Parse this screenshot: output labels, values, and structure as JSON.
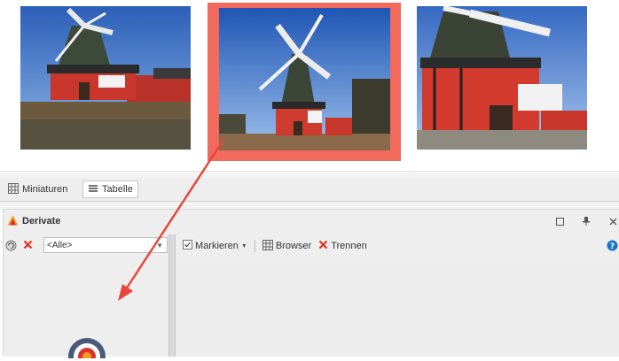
{
  "view_tabs": {
    "miniaturen": "Miniaturen",
    "tabelle": "Tabelle"
  },
  "panel": {
    "title": "Derivate",
    "header_buttons": [
      "maximize-icon",
      "pin-icon",
      "close-icon"
    ]
  },
  "filter": {
    "selected": "<Alle>"
  },
  "toolbar": {
    "markieren": "Markieren",
    "browser": "Browser",
    "trennen": "Trennen"
  },
  "colors": {
    "selection_highlight": "#f26a5b",
    "annotation_arrow": "#e8473c",
    "delete_red": "#e0301e",
    "help_blue": "#1a73c9"
  },
  "thumbnails": [
    {
      "subject": "windmill",
      "selected": false
    },
    {
      "subject": "windmill",
      "selected": true
    },
    {
      "subject": "windmill",
      "selected": false
    }
  ]
}
